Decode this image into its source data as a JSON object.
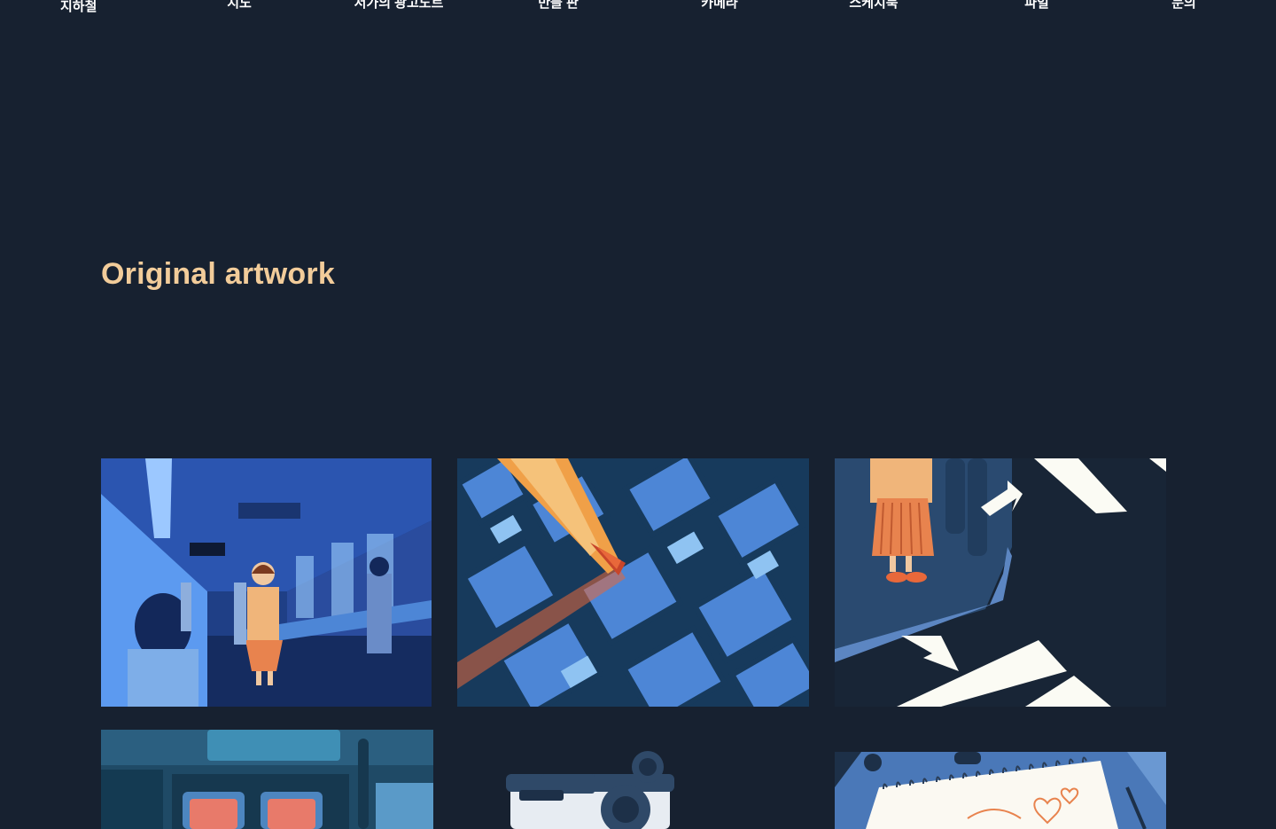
{
  "nav": {
    "logo": "지하철",
    "items": [
      "지도",
      "서가의 광고노트",
      "만들 판",
      "카메라",
      "스케치북",
      "파일",
      "문의"
    ]
  },
  "section": {
    "title": "Original artwork"
  },
  "colors": {
    "background": "#172130",
    "title": "#f2cc9a",
    "accent_blue": "#4d86d6",
    "accent_orange": "#e8683a"
  }
}
